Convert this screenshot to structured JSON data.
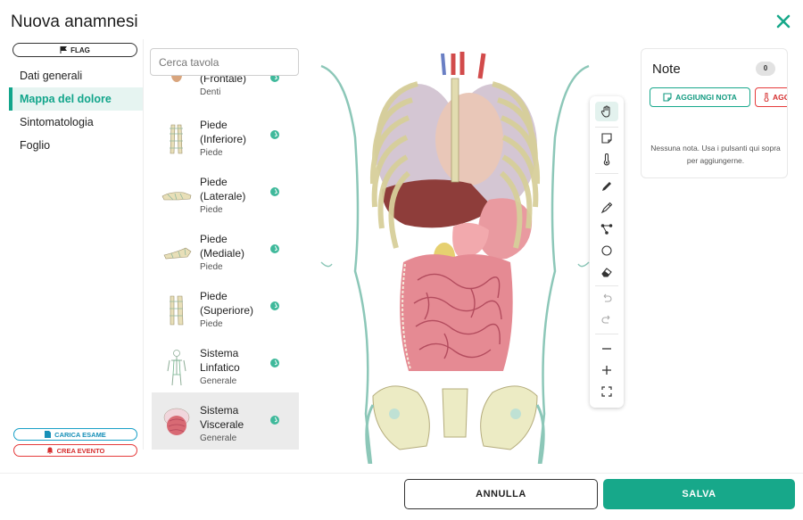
{
  "modal": {
    "title": "Nuova anamnesi"
  },
  "left_nav": {
    "flag_label": "FLAG",
    "items": [
      {
        "label": "Dati generali",
        "active": false
      },
      {
        "label": "Mappa del dolore",
        "active": true
      },
      {
        "label": "Sintomatologia",
        "active": false
      },
      {
        "label": "Foglio",
        "active": false
      }
    ],
    "carica_esame_label": "CARICA ESAME",
    "crea_evento_label": "CREA EVENTO"
  },
  "search": {
    "placeholder": "Cerca tavola"
  },
  "tables": [
    {
      "name": "(Frontale)",
      "category": "Denti"
    },
    {
      "name": "Piede (Inferiore)",
      "category": "Piede"
    },
    {
      "name": "Piede (Laterale)",
      "category": "Piede"
    },
    {
      "name": "Piede (Mediale)",
      "category": "Piede"
    },
    {
      "name": "Piede (Superiore)",
      "category": "Piede"
    },
    {
      "name": "Sistema Linfatico",
      "category": "Generale"
    },
    {
      "name": "Sistema Viscerale",
      "category": "Generale",
      "selected": true
    }
  ],
  "toolbar": {
    "tools": [
      "hand-icon",
      "sticky-note-icon",
      "thermometer-icon",
      "pencil-icon",
      "marker-icon",
      "connector-icon",
      "circle-icon",
      "eraser-icon",
      "undo-icon",
      "redo-icon",
      "zoom-out-icon",
      "zoom-in-icon",
      "fullscreen-icon"
    ]
  },
  "notes": {
    "title": "Note",
    "count": "0",
    "add_note_label": "AGGIUNGI NOTA",
    "add_other_label": "AGGI",
    "empty_text": "Nessuna nota. Usa i pulsanti qui sopra per aggiungerne."
  },
  "footer": {
    "cancel_label": "ANNULLA",
    "save_label": "SALVA"
  },
  "colors": {
    "accent": "#17a88a",
    "danger": "#e53b3b",
    "info": "#19a0c7"
  }
}
